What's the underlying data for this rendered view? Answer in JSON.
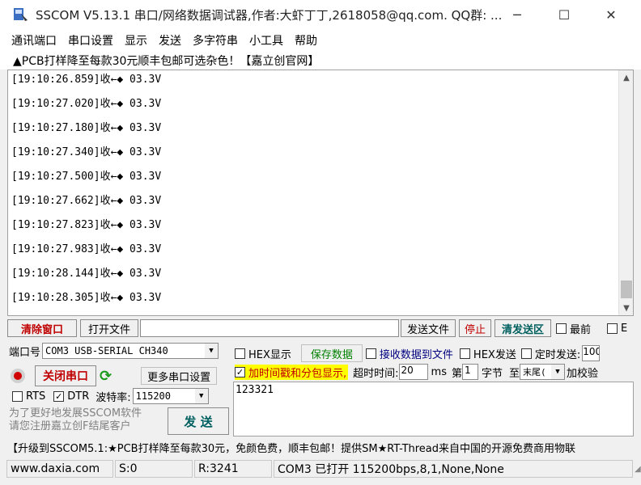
{
  "window": {
    "title": "SSCOM V5.13.1 串口/网络数据调试器,作者:大虾丁丁,2618058@qq.com. QQ群: ...",
    "minimize": "─",
    "maximize": "☐",
    "close": "✕"
  },
  "menu": [
    "通讯端口",
    "串口设置",
    "显示",
    "发送",
    "多字符串",
    "小工具",
    "帮助"
  ],
  "ad": "▲PCB打样降至每款30元顺丰包邮可选杂色！【嘉立创官网】",
  "receive": {
    "lines": [
      "[19:10:26.859]收←◆ 03.3V",
      "[19:10:27.020]收←◆ 03.3V",
      "[19:10:27.180]收←◆ 03.3V",
      "[19:10:27.340]收←◆ 03.3V",
      "[19:10:27.500]收←◆ 03.3V",
      "[19:10:27.662]收←◆ 03.3V",
      "[19:10:27.823]收←◆ 03.3V",
      "[19:10:27.983]收←◆ 03.3V",
      "[19:10:28.144]收←◆ 03.3V",
      "[19:10:28.305]收←◆ 03.3V"
    ]
  },
  "toolbar": {
    "clear": "清除窗口",
    "open_file": "打开文件",
    "file_path": "",
    "send_file": "发送文件",
    "stop": "停止",
    "clear_send": "清发送区",
    "topmost": "最前",
    "english": "E"
  },
  "port": {
    "label": "端口号",
    "value": "COM3 USB-SERIAL CH340",
    "close_port": "关闭串口",
    "more_settings": "更多串口设置",
    "rts": "RTS",
    "rts_checked": false,
    "dtr": "DTR",
    "dtr_checked": true,
    "baud_label": "波特率:",
    "baud_value": "115200"
  },
  "promo": {
    "line1": "为了更好地发展SSCOM软件",
    "line2": "请您注册嘉立创F结尾客户"
  },
  "send_button": "发  送",
  "options": {
    "hex_display": "HEX显示",
    "hex_display_checked": false,
    "save_data": "保存数据",
    "recv_to_file": "接收数据到文件",
    "recv_to_file_checked": false,
    "hex_send": "HEX发送",
    "hex_send_checked": false,
    "timed_send": "定时发送:",
    "timed_send_checked": false,
    "timed_value": "100",
    "timestamp": "加时间戳和分包显示,",
    "timestamp_checked": true,
    "timeout_label": "超时时间:",
    "timeout_value": "20",
    "timeout_unit": "ms",
    "nth_label": "第",
    "nth_value": "1",
    "byte_label": "字节",
    "to_label": "至",
    "end_value": "末尾(",
    "checksum": "加校验"
  },
  "send_text": "123321",
  "banner": "【升级到SSCOM5.1:★PCB打样降至每款30元，免颜色费，顺丰包邮！提供SM★RT-Thread来自中国的开源免费商用物联",
  "status": {
    "site": "www.daxia.com",
    "sent": "S:0",
    "received": "R:3241",
    "port_status": "COM3 已打开  115200bps,8,1,None,None"
  },
  "colors": {
    "highlight": "#ffff00",
    "stop_red": "#c00000",
    "save_green": "#008000"
  }
}
